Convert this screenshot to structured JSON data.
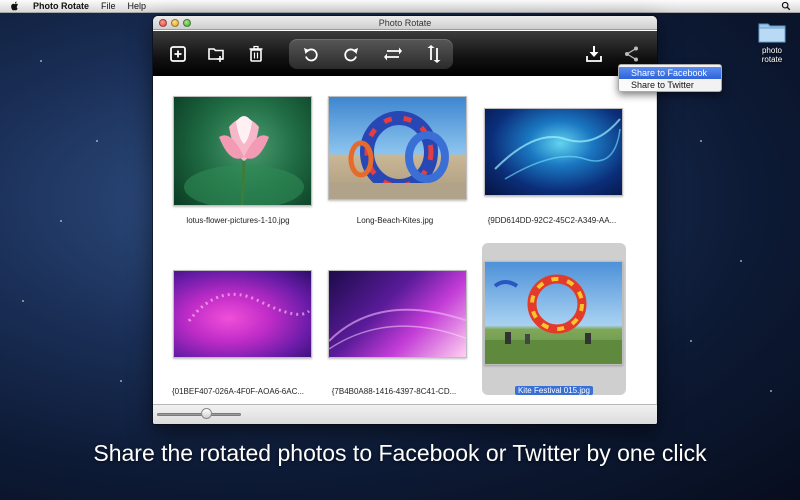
{
  "menubar": {
    "app_name": "Photo Rotate",
    "items": [
      "File",
      "Help"
    ]
  },
  "desktop": {
    "folder_label": "photo rotate"
  },
  "window": {
    "title": "Photo Rotate",
    "toolbar": {
      "left_icons": [
        "add-photo-icon",
        "add-folder-icon",
        "trash-icon"
      ],
      "group_icons": [
        "rotate-left-icon",
        "rotate-right-icon",
        "flip-horizontal-icon",
        "flip-vertical-icon"
      ],
      "right_icons": [
        "save-download-icon",
        "share-icon"
      ]
    },
    "photos": [
      {
        "name": "lotus-flower-pictures-1-10.jpg",
        "selected": false
      },
      {
        "name": "Long-Beach-Kites.jpg",
        "selected": false
      },
      {
        "name": "{9DD614DD-92C2-45C2-A349-AA...",
        "selected": false
      },
      {
        "name": "{01BEF407-026A-4F0F-AOA6-6AC...",
        "selected": false
      },
      {
        "name": "{7B4B0A88-1416-4397-8C41-CD...",
        "selected": false
      },
      {
        "name": "Kite Festival 015.jpg",
        "selected": true
      }
    ],
    "zoom_slider": 0.6
  },
  "share_menu": {
    "items": [
      "Share to Facebook",
      "Share to Twitter"
    ],
    "highlighted": "Share to Facebook"
  },
  "tagline": "Share the rotated photos to Facebook or Twitter by one click",
  "colors": {
    "selection": "#3b6fd4",
    "toolbar": "#111111"
  }
}
